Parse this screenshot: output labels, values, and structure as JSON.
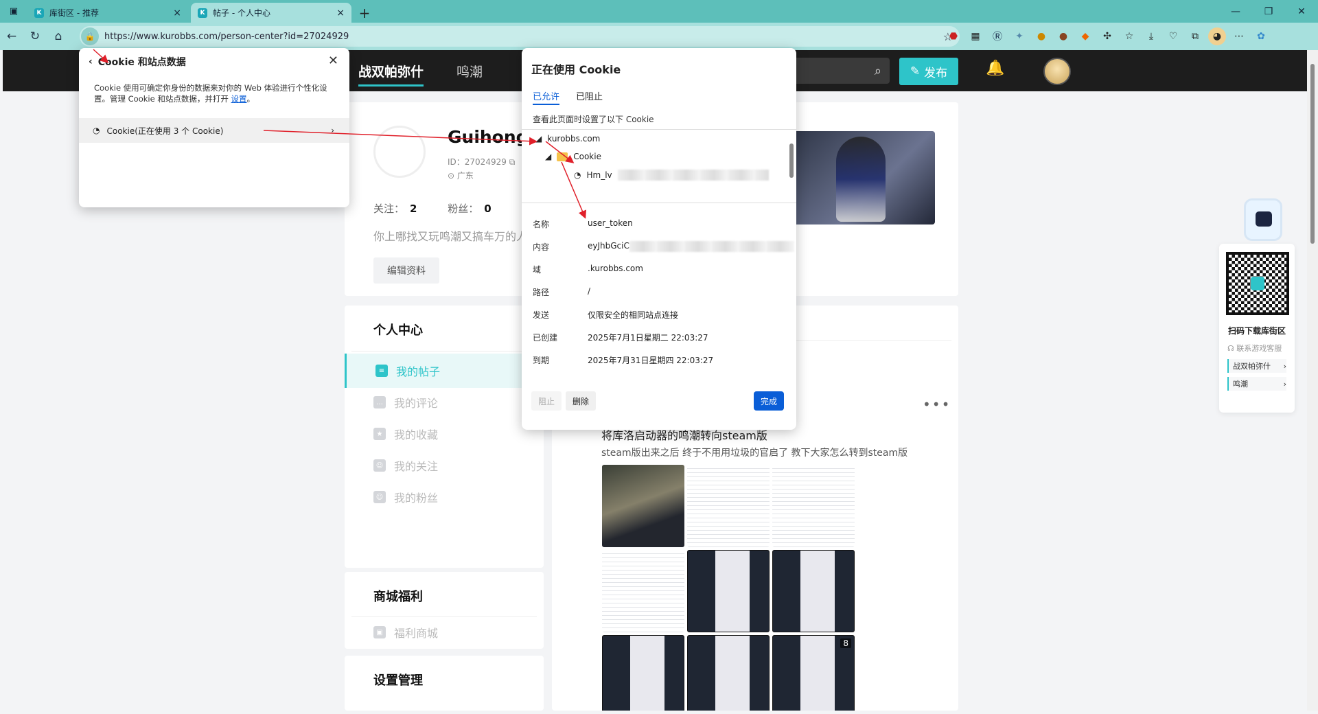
{
  "browser": {
    "tabs": [
      {
        "title": "库街区 - 推荐",
        "close": "×"
      },
      {
        "title": "帖子 - 个人中心",
        "close": "×"
      }
    ],
    "new_tab": "+",
    "url": "https://www.kurobbs.com/person-center?id=27024929"
  },
  "site": {
    "nav": [
      "战双帕弥什",
      "鸣潮"
    ],
    "post_button": "发布",
    "profile": {
      "name": "Guihong\\",
      "id": "ID：27024929",
      "location": "广东",
      "following_label": "关注：",
      "following": "2",
      "fans_label": "粉丝：",
      "fans": "0",
      "bio": "你上哪找又玩鸣潮又搞车万的人",
      "edit_button": "编辑资料"
    },
    "sidebar": {
      "title": "个人中心",
      "items": [
        "我的帖子",
        "我的评论",
        "我的收藏",
        "我的关注",
        "我的粉丝"
      ],
      "mall_title": "商城福利",
      "mall_item": "福利商城",
      "settings_title": "设置管理"
    },
    "post": {
      "title": "将库洛启动器的鸣潮转向steam版",
      "desc": "steam版出来之后 终于不用用垃圾的官启了 教下大家怎么转到steam版",
      "image_count": "8",
      "more": "•••"
    },
    "float": {
      "qr_caption": "扫码下载库街区",
      "service": "联系游戏客服",
      "links": [
        "战双帕弥什",
        "鸣潮"
      ]
    }
  },
  "site_data_popup": {
    "title": "Cookie 和站点数据",
    "desc": "Cookie 使用可确定你身份的数据来对你的 Web 体验进行个性化设置。管理 Cookie 和站点数据，并打开 ",
    "desc_link": "设置",
    "desc_end": "。",
    "row": "Cookie(正在使用 3 个 Cookie)"
  },
  "cookie_popup": {
    "title": "正在使用 Cookie",
    "tabs": [
      "已允许",
      "已阻止"
    ],
    "note": "查看此页面时设置了以下 Cookie",
    "tree": {
      "domain": "kurobbs.com",
      "folder": "Cookie",
      "item": "Hm_lv"
    },
    "details": [
      {
        "k": "名称",
        "v": "user_token"
      },
      {
        "k": "内容",
        "v": "eyJhbGciC"
      },
      {
        "k": "域",
        "v": ".kurobbs.com"
      },
      {
        "k": "路径",
        "v": "/"
      },
      {
        "k": "发送",
        "v": "仅限安全的相同站点连接"
      },
      {
        "k": "已创建",
        "v": "2025年7月1日星期二 22:03:27"
      },
      {
        "k": "到期",
        "v": "2025年7月31日星期四 22:03:27"
      }
    ],
    "block": "阻止",
    "delete": "删除",
    "done": "完成"
  },
  "colors": {
    "accent": "#2ec4c9",
    "edge_blue": "#0a5ed7",
    "annotation": "#e0202a"
  }
}
